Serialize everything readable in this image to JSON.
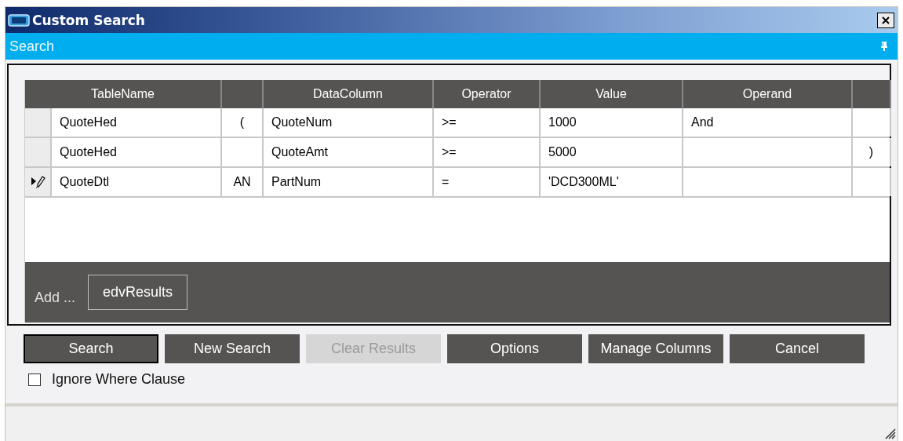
{
  "window": {
    "title": "Custom Search"
  },
  "pane": {
    "title": "Search"
  },
  "grid": {
    "columns": [
      {
        "label": "TableName"
      },
      {},
      {
        "label": "DataColumn"
      },
      {
        "label": "Operator"
      },
      {
        "label": "Value"
      },
      {
        "label": "Operand"
      },
      {}
    ],
    "rows": [
      {
        "current": false,
        "cells": [
          "QuoteHed",
          "(",
          "QuoteNum",
          ">=",
          "1000",
          "And",
          null
        ]
      },
      {
        "current": false,
        "cells": [
          "QuoteHed",
          null,
          "QuoteAmt",
          ">=",
          "5000",
          null,
          ")"
        ]
      },
      {
        "current": true,
        "cells": [
          "QuoteDtl",
          "AN",
          "PartNum",
          "=",
          "'DCD300ML'",
          null,
          null
        ]
      }
    ]
  },
  "add_bar": {
    "label": "Add ...",
    "items": [
      "edvResults"
    ]
  },
  "buttons": [
    {
      "label": "Search",
      "default": true,
      "disabled": false
    },
    {
      "label": "New Search",
      "default": false,
      "disabled": false
    },
    {
      "label": "Clear Results",
      "default": false,
      "disabled": true
    },
    {
      "label": "Options",
      "default": false,
      "disabled": false
    },
    {
      "label": "Manage Columns",
      "default": false,
      "disabled": false
    },
    {
      "label": "Cancel",
      "default": false,
      "disabled": false
    }
  ],
  "ignore_where": {
    "label": "Ignore Where Clause",
    "checked": false
  }
}
